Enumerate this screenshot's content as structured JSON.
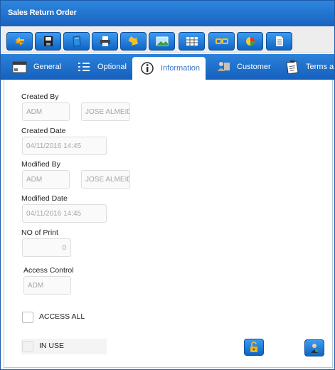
{
  "window": {
    "title": "Sales Return Order"
  },
  "toolbar": {
    "buttons": [
      {
        "name": "refresh-icon"
      },
      {
        "name": "save-icon"
      },
      {
        "name": "notebook-icon"
      },
      {
        "name": "print-icon"
      },
      {
        "name": "arrow-down-icon"
      },
      {
        "name": "image-icon"
      },
      {
        "name": "grid-icon"
      },
      {
        "name": "link-icon"
      },
      {
        "name": "chart-icon"
      },
      {
        "name": "document-icon"
      }
    ]
  },
  "tabs": [
    {
      "label": "General",
      "icon": "window-icon"
    },
    {
      "label": "Optional",
      "icon": "list-icon"
    },
    {
      "label": "Information",
      "icon": "info-icon",
      "active": true
    },
    {
      "label": "Customer",
      "icon": "customer-icon"
    },
    {
      "label": "Terms and",
      "icon": "clipboard-icon"
    }
  ],
  "form": {
    "created_by_label": "Created By",
    "created_by_code": "ADM",
    "created_by_name": "JOSE ALMEID",
    "created_date_label": "Created Date",
    "created_date": "04/11/2016 14:45",
    "modified_by_label": "Modified By",
    "modified_by_code": "ADM",
    "modified_by_name": "JOSE ALMEID",
    "modified_date_label": "Modified Date",
    "modified_date": "04/11/2016 14:45",
    "no_print_label": "NO of Print",
    "no_print": "0",
    "access_control_label": "Access Control",
    "access_control": "ADM",
    "access_all_label": "ACCESS ALL",
    "in_use_label": "IN USE"
  },
  "colors": {
    "accent": "#1a63bf",
    "active_tab_text": "#3b79c4"
  }
}
